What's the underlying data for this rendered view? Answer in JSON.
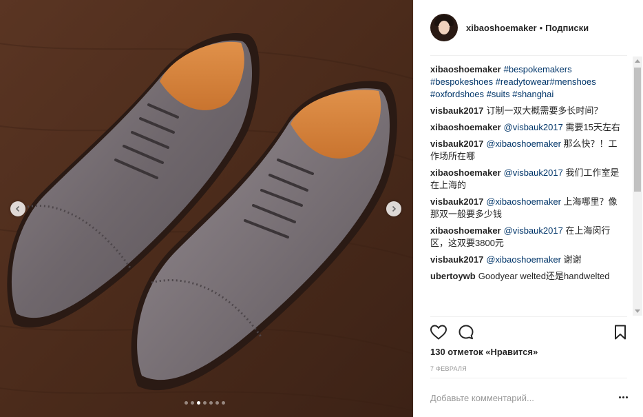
{
  "post": {
    "carousel": {
      "slide_count": 7,
      "active_slide": 3,
      "prev_icon": "chevron-left-icon",
      "next_icon": "chevron-right-icon"
    },
    "header": {
      "username": "xibaoshoemaker",
      "separator": "•",
      "follow_label": "Подписки"
    },
    "comments": [
      {
        "user": "xibaoshoemaker",
        "text": "#bespokemakers #bespokeshoes #readytowear#menshoes #oxfordshoes #suits #shanghai"
      },
      {
        "user": "visbauk2017",
        "text": "订制一双大概需要多长时间？"
      },
      {
        "user": "xibaoshoemaker",
        "text": "@visbauk2017 需要15天左右"
      },
      {
        "user": "visbauk2017",
        "text": "@xibaoshoemaker 那么快？！工作场所在哪"
      },
      {
        "user": "xibaoshoemaker",
        "text": "@visbauk2017 我们工作室是在上海的"
      },
      {
        "user": "visbauk2017",
        "text": "@xibaoshoemaker 上海哪里？像那双一般要多少钱"
      },
      {
        "user": "xibaoshoemaker",
        "text": "@visbauk2017 在上海闵行区，这双要3800元"
      },
      {
        "user": "visbauk2017",
        "text": "@xibaoshoemaker 谢谢"
      },
      {
        "user": "ubertoywb",
        "text": "Goodyear welted还是handwelted"
      }
    ],
    "actions": {
      "like_icon": "heart-icon",
      "comment_icon": "comment-icon",
      "save_icon": "bookmark-icon"
    },
    "likes_text": "130 отметок «Нравится»",
    "date": "7 февраля",
    "add_comment_placeholder": "Добавьте комментарий...",
    "more_icon": "more-options-icon"
  },
  "colors": {
    "text": "#262626",
    "link": "#003569",
    "muted": "#999999",
    "divider": "#efefef"
  }
}
